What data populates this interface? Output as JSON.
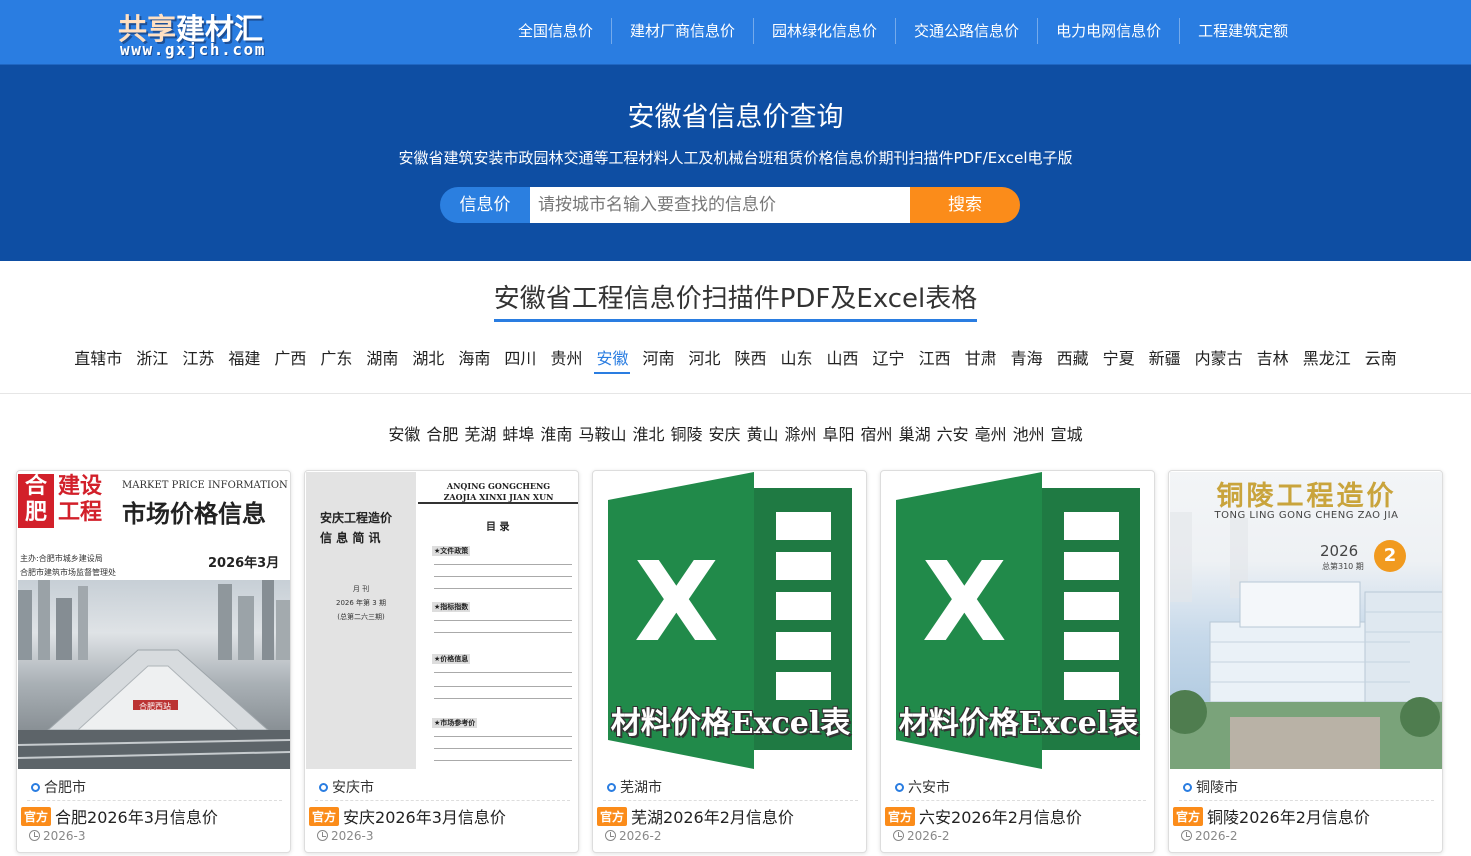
{
  "logo": {
    "main_a": "共享",
    "main_b": "建材汇",
    "sub": "www.gxjch.com"
  },
  "nav": [
    "全国信息价",
    "建材厂商信息价",
    "园林绿化信息价",
    "交通公路信息价",
    "电力电网信息价",
    "工程建筑定额"
  ],
  "hero": {
    "title": "安徽省信息价查询",
    "subtitle": "安徽省建筑安装市政园林交通等工程材料人工及机械台班租赁价格信息价期刊扫描件PDF/Excel电子版",
    "search_tag": "信息价",
    "search_placeholder": "请按城市名输入要查找的信息价",
    "search_button": "搜索"
  },
  "section_title": "安徽省工程信息价扫描件PDF及Excel表格",
  "provinces": [
    "直辖市",
    "浙江",
    "江苏",
    "福建",
    "广西",
    "广东",
    "湖南",
    "湖北",
    "海南",
    "四川",
    "贵州",
    "安徽",
    "河南",
    "河北",
    "陕西",
    "山东",
    "山西",
    "辽宁",
    "江西",
    "甘肃",
    "青海",
    "西藏",
    "宁夏",
    "新疆",
    "内蒙古",
    "吉林",
    "黑龙江",
    "云南"
  ],
  "active_province": "安徽",
  "cities": [
    "安徽",
    "合肥",
    "芜湖",
    "蚌埠",
    "淮南",
    "马鞍山",
    "淮北",
    "铜陵",
    "安庆",
    "黄山",
    "滁州",
    "阜阳",
    "宿州",
    "巢湖",
    "六安",
    "亳州",
    "池州",
    "宣城"
  ],
  "cards": [
    {
      "city": "合肥市",
      "badge": "官方",
      "title": "合肥2026年3月信息价",
      "date": "2026-3"
    },
    {
      "city": "安庆市",
      "badge": "官方",
      "title": "安庆2026年3月信息价",
      "date": "2026-3"
    },
    {
      "city": "芜湖市",
      "badge": "官方",
      "title": "芜湖2026年2月信息价",
      "date": "2026-2"
    },
    {
      "city": "六安市",
      "badge": "官方",
      "title": "六安2026年2月信息价",
      "date": "2026-2"
    },
    {
      "city": "铜陵市",
      "badge": "官方",
      "title": "铜陵2026年2月信息价",
      "date": "2026-2"
    }
  ],
  "covers": {
    "hefei": {
      "block": "合肥",
      "word": "建设工程",
      "mpi": "MARKET PRICE INFORMATION",
      "big": "市场价格信息",
      "org1": "主办:合肥市城乡建设局",
      "org2": "合肥市建筑市场监督管理处",
      "date": "2026年3月",
      "station": "合肥西站"
    },
    "anqing": {
      "top1": "ANQING GONGCHENG",
      "top2": "ZAOJIA XINXI JIAN XUN",
      "mulu": "目  录",
      "left1": "安庆工程造价",
      "left2": "信 息 简 讯",
      "yk1": "月  刊",
      "yk2": "2026 年第 3 期",
      "yk3": "(总第二六三期)",
      "tags": [
        "★文件政策",
        "★指标指数",
        "★价格信息",
        "★市场参考价"
      ]
    },
    "excel": {
      "letter": "X",
      "caption": "材料价格Excel表"
    },
    "tongling": {
      "title": "铜陵工程造价",
      "pinyin": "TONG LING GONG CHENG ZAO JIA",
      "year": "2026",
      "issue": "2",
      "total": "总第310 期"
    }
  },
  "colors": {
    "nav_blue": "#2a7de1",
    "hero_blue": "#0e4ea3",
    "orange": "#fb8c1a",
    "excel_green": "#1f7a43"
  }
}
